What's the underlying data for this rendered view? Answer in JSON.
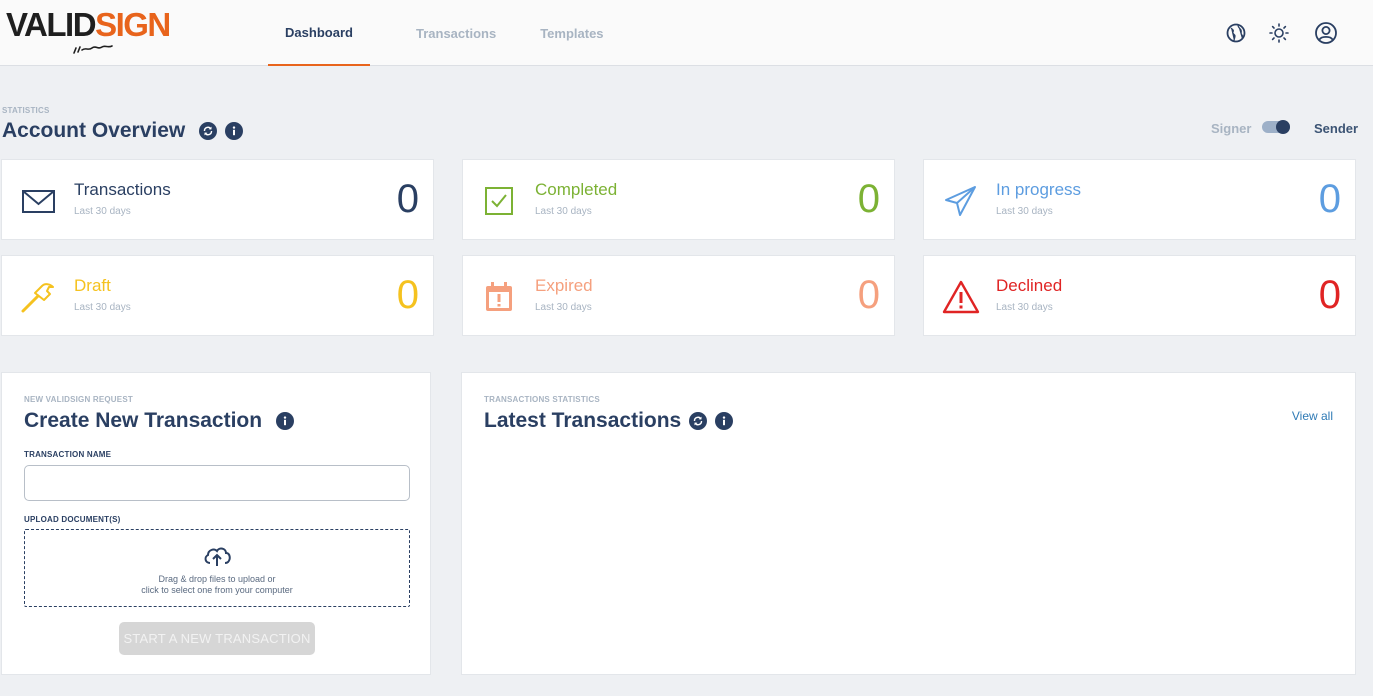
{
  "brand": {
    "name_part1": "VALID",
    "name_part2": "SIGN",
    "accent_color": "#e8641c"
  },
  "nav": {
    "items": [
      {
        "label": "Dashboard",
        "active": true
      },
      {
        "label": "Transactions",
        "active": false
      },
      {
        "label": "Templates",
        "active": false
      }
    ],
    "icons": [
      "globe-icon",
      "sun-icon",
      "user-circle-icon"
    ]
  },
  "statistics": {
    "eyebrow": "STATISTICS",
    "title": "Account Overview",
    "toggle": {
      "left_label": "Signer",
      "right_label": "Sender",
      "selected": "Sender"
    }
  },
  "stat_cards": [
    {
      "label": "Transactions",
      "subtitle": "Last 30 days",
      "value": "0",
      "color": "#2a3f62",
      "icon": "envelope-icon"
    },
    {
      "label": "Completed",
      "subtitle": "Last 30 days",
      "value": "0",
      "color": "#7cb234",
      "icon": "checkbox-icon"
    },
    {
      "label": "In progress",
      "subtitle": "Last 30 days",
      "value": "0",
      "color": "#5d9de0",
      "icon": "paper-plane-icon"
    },
    {
      "label": "Draft",
      "subtitle": "Last 30 days",
      "value": "0",
      "color": "#f5c21f",
      "icon": "hammer-icon"
    },
    {
      "label": "Expired",
      "subtitle": "Last 30 days",
      "value": "0",
      "color": "#f5a07e",
      "icon": "calendar-alert-icon"
    },
    {
      "label": "Declined",
      "subtitle": "Last 30 days",
      "value": "0",
      "color": "#e02424",
      "icon": "warning-triangle-icon"
    }
  ],
  "create": {
    "eyebrow": "NEW VALIDSIGN REQUEST",
    "title": "Create New Transaction",
    "name_label": "TRANSACTION NAME",
    "name_value": "",
    "upload_label": "UPLOAD DOCUMENT(S)",
    "drop_line1": "Drag & drop files to upload or",
    "drop_line2": "click to select one from your computer",
    "start_button": "START A NEW TRANSACTION"
  },
  "latest": {
    "eyebrow": "TRANSACTIONS STATISTICS",
    "title": "Latest Transactions",
    "view_all": "View all"
  }
}
